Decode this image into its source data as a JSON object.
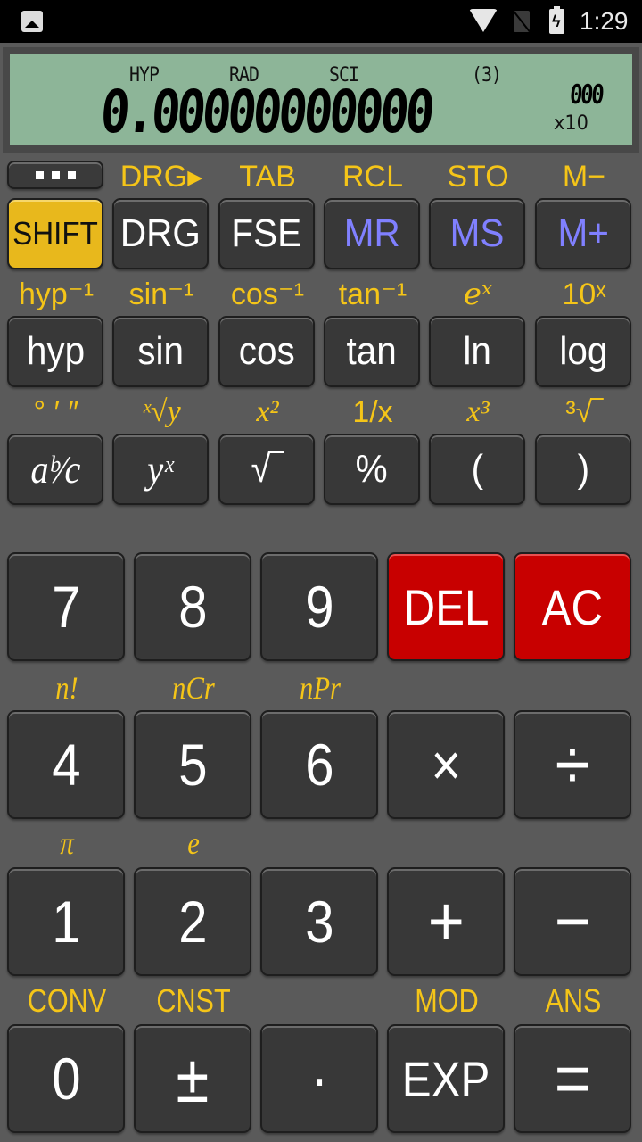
{
  "status_bar": {
    "time": "1:29",
    "icons": [
      "image-notification-icon",
      "wifi-icon",
      "no-sim-icon",
      "battery-charging-icon"
    ]
  },
  "display": {
    "indicators": {
      "hyp": "HYP",
      "angle_mode": "RAD",
      "format": "SCI",
      "precision": "(3)"
    },
    "value": "0.00000000000",
    "exponent": "000",
    "exponent_label": "x10"
  },
  "colors": {
    "background": "#5a5a5a",
    "lcd": "#8db598",
    "key": "#383838",
    "shift_key": "#e8b81c",
    "danger_key": "#c80000",
    "memory_text": "#8080ff",
    "secondary_label": "#f5c518"
  },
  "function_rows": [
    {
      "shift_labels": [
        "",
        "DRG▸",
        "TAB",
        "RCL",
        "STO",
        "M−"
      ],
      "keys": [
        {
          "label": "SHIFT",
          "type": "shift"
        },
        {
          "label": "DRG",
          "type": "normal"
        },
        {
          "label": "FSE",
          "type": "normal"
        },
        {
          "label": "MR",
          "type": "memory"
        },
        {
          "label": "MS",
          "type": "memory"
        },
        {
          "label": "M+",
          "type": "memory"
        }
      ]
    },
    {
      "shift_labels": [
        "hyp⁻¹",
        "sin⁻¹",
        "cos⁻¹",
        "tan⁻¹",
        "eˣ",
        "10ˣ"
      ],
      "keys": [
        {
          "label": "hyp"
        },
        {
          "label": "sin"
        },
        {
          "label": "cos"
        },
        {
          "label": "tan"
        },
        {
          "label": "ln"
        },
        {
          "label": "log"
        }
      ]
    },
    {
      "shift_labels": [
        "° ′ ″",
        "ˣ√y",
        "x²",
        "1/x",
        "x³",
        "³√‾"
      ],
      "keys": [
        {
          "label": "aᵇ⁄c"
        },
        {
          "label": "yˣ"
        },
        {
          "label": "√‾"
        },
        {
          "label": "%"
        },
        {
          "label": "("
        },
        {
          "label": ")"
        }
      ]
    }
  ],
  "menu_button": {
    "label": "more-options"
  },
  "number_rows": [
    {
      "shift_labels": [
        "",
        "",
        "",
        "",
        ""
      ],
      "keys": [
        {
          "label": "7"
        },
        {
          "label": "8"
        },
        {
          "label": "9"
        },
        {
          "label": "DEL",
          "type": "danger"
        },
        {
          "label": "AC",
          "type": "danger"
        }
      ]
    },
    {
      "shift_labels": [
        "n!",
        "nCr",
        "nPr",
        "",
        ""
      ],
      "keys": [
        {
          "label": "4"
        },
        {
          "label": "5"
        },
        {
          "label": "6"
        },
        {
          "label": "×"
        },
        {
          "label": "÷"
        }
      ]
    },
    {
      "shift_labels": [
        "π",
        "e",
        "",
        "",
        ""
      ],
      "keys": [
        {
          "label": "1"
        },
        {
          "label": "2"
        },
        {
          "label": "3"
        },
        {
          "label": "+"
        },
        {
          "label": "−"
        }
      ]
    },
    {
      "shift_labels": [
        "CONV",
        "CNST",
        "",
        "MOD",
        "ANS"
      ],
      "keys": [
        {
          "label": "0"
        },
        {
          "label": "±"
        },
        {
          "label": "·"
        },
        {
          "label": "EXP"
        },
        {
          "label": "="
        }
      ]
    }
  ]
}
